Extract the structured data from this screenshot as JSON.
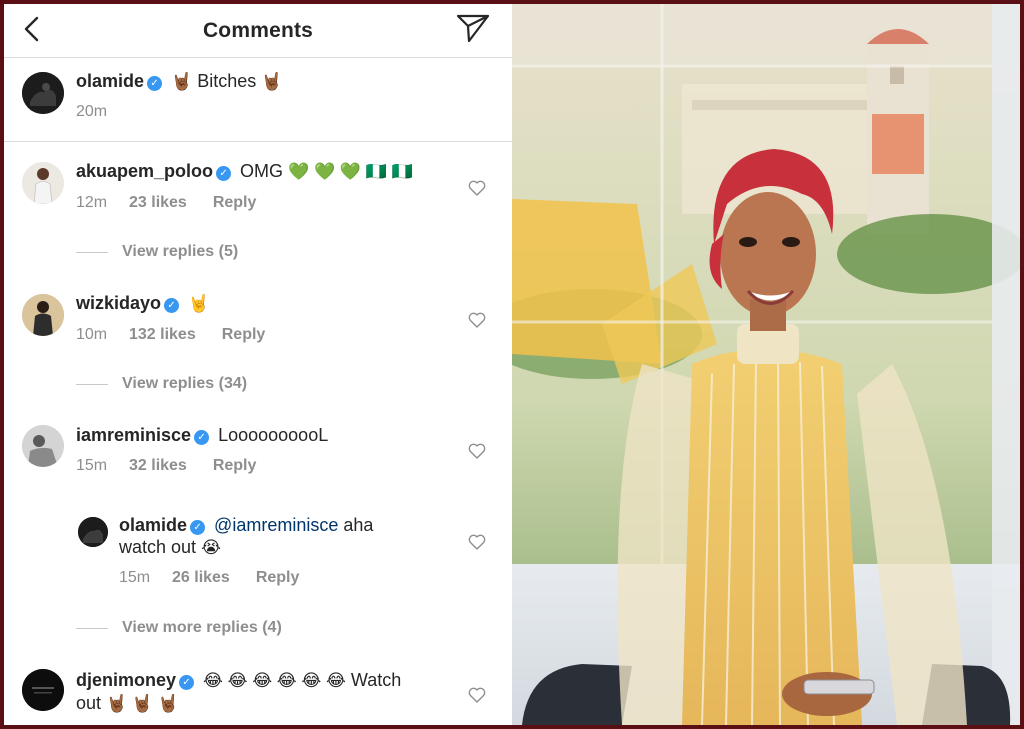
{
  "header": {
    "title": "Comments"
  },
  "caption": {
    "username": "olamide",
    "verified_mark": "✓",
    "emoji_left": "🤘🏾",
    "text": "Bitches",
    "emoji_right": "🤘🏾",
    "time": "20m"
  },
  "comments": [
    {
      "username": "akuapem_poloo",
      "text": "OMG",
      "emojis": "💚 💚 💚 🇳🇬 🇳🇬",
      "time": "12m",
      "likes": "23 likes",
      "reply_label": "Reply",
      "view_replies": "View replies (5)"
    },
    {
      "username": "wizkidayo",
      "text": "",
      "emojis": "🤘",
      "time": "10m",
      "likes": "132 likes",
      "reply_label": "Reply",
      "view_replies": "View replies (34)"
    },
    {
      "username": "iamreminisce",
      "text": "LoooooooooL",
      "emojis": "",
      "time": "15m",
      "likes": "32 likes",
      "reply_label": "Reply"
    }
  ],
  "reply": {
    "username": "olamide",
    "mention": "@iamreminisce",
    "text": "aha",
    "text2": "watch out",
    "emoji": "😭",
    "time": "15m",
    "likes": "26 likes",
    "reply_label": "Reply",
    "view_more": "View more replies (4)"
  },
  "last_comment": {
    "username": "djenimoney",
    "emojis": "😂 😂 😂 😂 😂 😂",
    "text": "Watch",
    "text2": "out",
    "emojis2": "🤘🏾 🤘🏾 🤘🏾"
  },
  "icons": {
    "back": "chevron-left-icon",
    "send": "paper-plane-icon",
    "like": "heart-outline-icon",
    "verified": "verified-badge-icon"
  },
  "colors": {
    "verified": "#3897f0",
    "secondary_text": "#8e8e8e",
    "border": "#dbdbdb",
    "frame": "#5a0f15"
  }
}
